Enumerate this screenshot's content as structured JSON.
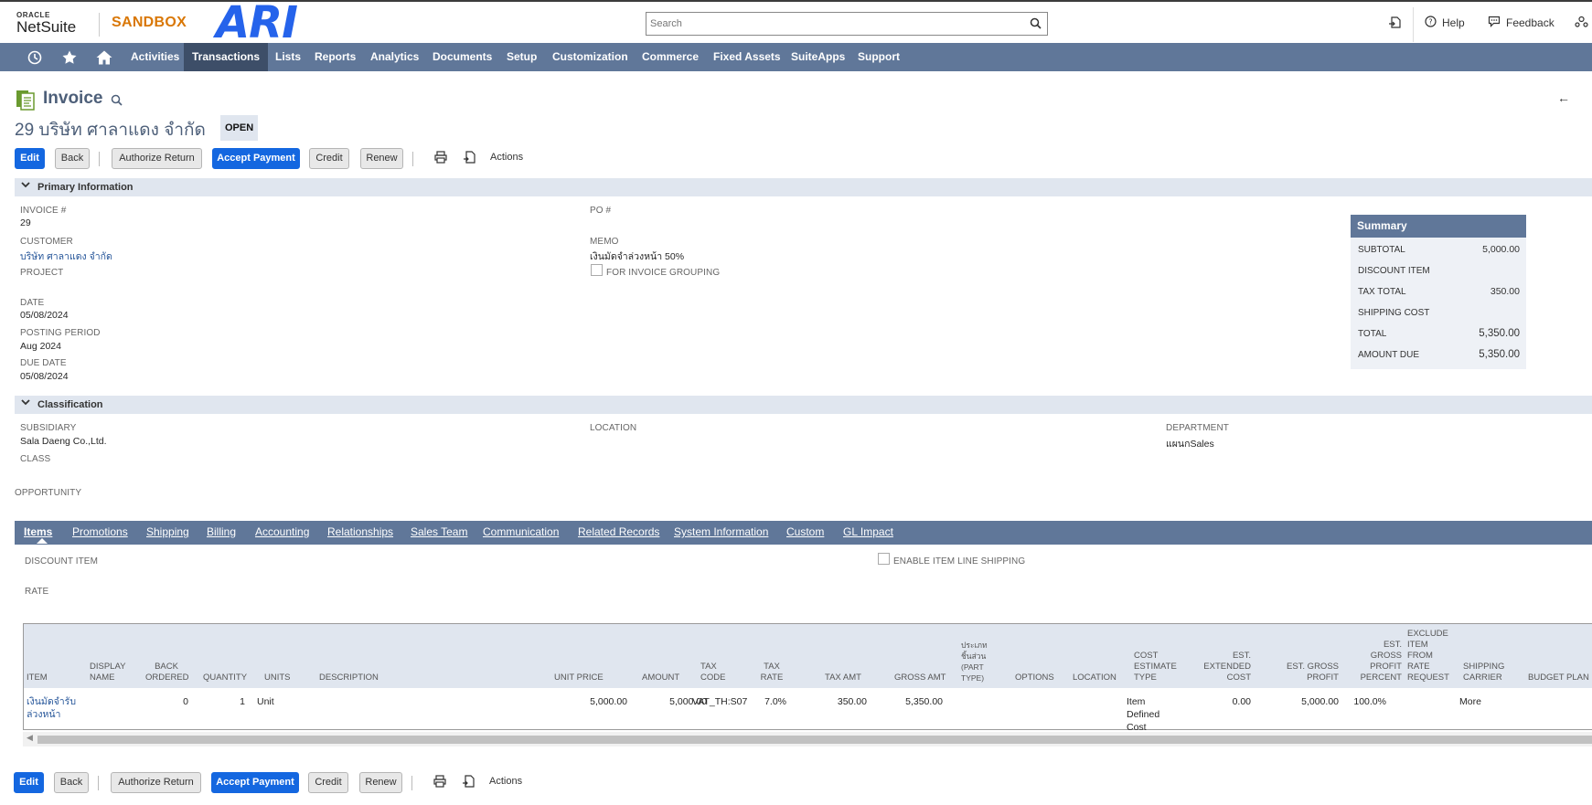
{
  "header": {
    "logo_oracle": "ORACLE",
    "logo_netsuite": "NetSuite",
    "environment": "SANDBOX",
    "brand_overlay": "ARI",
    "search_placeholder": "Search",
    "help_label": "Help",
    "feedback_label": "Feedback"
  },
  "nav": {
    "items": [
      "Activities",
      "Transactions",
      "Lists",
      "Reports",
      "Analytics",
      "Documents",
      "Setup",
      "Customization",
      "Commerce",
      "Fixed Assets",
      "SuiteApps",
      "Support"
    ],
    "active": "Transactions"
  },
  "record": {
    "type": "Invoice",
    "number_name": "29 บริษัท ศาลาแดง จำกัด",
    "status": "OPEN"
  },
  "buttons": {
    "edit": "Edit",
    "back": "Back",
    "authorize_return": "Authorize Return",
    "accept_payment": "Accept Payment",
    "credit": "Credit",
    "renew": "Renew",
    "actions": "Actions"
  },
  "primary": {
    "section_title": "Primary Information",
    "invoice_label": "INVOICE #",
    "invoice_value": "29",
    "customer_label": "CUSTOMER",
    "customer_value": "บริษัท ศาลาแดง จำกัด",
    "project_label": "PROJECT",
    "date_label": "DATE",
    "date_value": "05/08/2024",
    "posting_period_label": "POSTING PERIOD",
    "posting_period_value": "Aug 2024",
    "due_date_label": "DUE DATE",
    "due_date_value": "05/08/2024",
    "po_label": "PO #",
    "memo_label": "MEMO",
    "memo_value": "เงินมัดจำล่วงหน้า 50%",
    "for_invoice_grouping_label": "FOR INVOICE GROUPING"
  },
  "summary": {
    "title": "Summary",
    "rows": [
      {
        "label": "SUBTOTAL",
        "value": "5,000.00"
      },
      {
        "label": "DISCOUNT ITEM",
        "value": ""
      },
      {
        "label": "TAX TOTAL",
        "value": "350.00"
      },
      {
        "label": "SHIPPING COST",
        "value": ""
      },
      {
        "label": "TOTAL",
        "value": "5,350.00"
      },
      {
        "label": "AMOUNT DUE",
        "value": "5,350.00"
      }
    ]
  },
  "classification": {
    "section_title": "Classification",
    "subsidiary_label": "SUBSIDIARY",
    "subsidiary_value": "Sala Daeng Co.,Ltd.",
    "class_label": "CLASS",
    "location_label": "LOCATION",
    "department_label": "DEPARTMENT",
    "department_value": "แผนกSales",
    "opportunity_label": "OPPORTUNITY"
  },
  "tabs": [
    "Items",
    "Promotions",
    "Shipping",
    "Billing",
    "Accounting",
    "Relationships",
    "Sales Team",
    "Communication",
    "Related Records",
    "System Information",
    "Custom",
    "GL Impact"
  ],
  "items_tab": {
    "discount_item_label": "DISCOUNT ITEM",
    "rate_label": "RATE",
    "enable_line_shipping_label": "ENABLE ITEM LINE SHIPPING",
    "columns": {
      "item": "ITEM",
      "display_name": "DISPLAY NAME",
      "back_ordered": "BACK ORDERED",
      "quantity": "QUANTITY",
      "units": "UNITS",
      "description": "DESCRIPTION",
      "unit_price": "UNIT PRICE",
      "amount": "AMOUNT",
      "tax_code": "TAX CODE",
      "tax_rate": "TAX RATE",
      "tax_amt": "TAX AMT",
      "gross_amt": "GROSS AMT",
      "part_type": "ประเภท ชิ้นส่วน (PART TYPE)",
      "options": "OPTIONS",
      "location": "LOCATION",
      "cost_estimate_type": "COST ESTIMATE TYPE",
      "est_extended_cost": "EST. EXTENDED COST",
      "est_gross_profit": "EST. GROSS PROFIT",
      "est_gross_profit_percent": "EST. GROSS PROFIT PERCENT",
      "exclude_item": "EXCLUDE ITEM FROM RATE REQUEST",
      "shipping_carrier": "SHIPPING CARRIER",
      "budget_plan": "BUDGET PLAN"
    },
    "row": {
      "item": "เงินมัดจำรับ ล่วงหน้า",
      "back_ordered": "0",
      "quantity": "1",
      "units": "Unit",
      "unit_price": "5,000.00",
      "amount": "5,000.00",
      "tax_code": "VAT_TH:S07",
      "tax_rate": "7.0%",
      "tax_amt": "350.00",
      "gross_amt": "5,350.00",
      "cost_estimate_type": "Item Defined Cost",
      "est_extended_cost": "0.00",
      "est_gross_profit": "5,000.00",
      "est_gross_profit_percent": "100.0%",
      "shipping_carrier": "More"
    }
  }
}
